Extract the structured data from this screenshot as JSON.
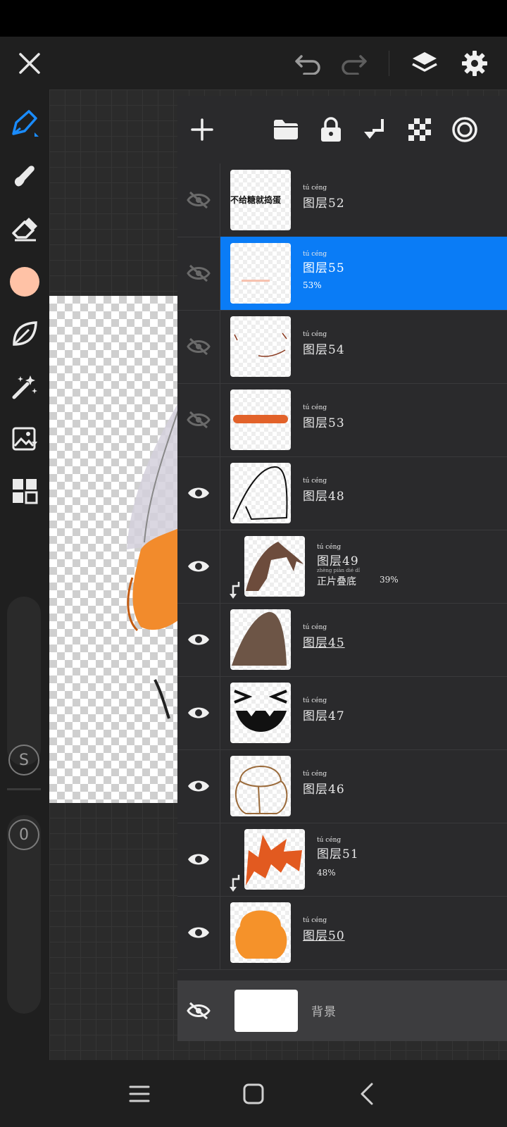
{
  "app": {
    "accent_color": "#0a7cf6",
    "brush_color": "#ffc2a6"
  },
  "top_bar": {
    "icons": [
      "close-icon",
      "undo-icon",
      "redo-icon",
      "layers-icon",
      "settings-icon"
    ]
  },
  "left_toolbar": {
    "tools": [
      "pen-icon",
      "smudge-icon",
      "eraser-icon",
      "color-swatch",
      "shape-leaf-icon",
      "magic-wand-icon",
      "image-import-icon",
      "materials-grid-icon"
    ],
    "size_label": "S",
    "opacity_label": "0"
  },
  "layers_toolbar": {
    "icons": [
      "add-layer-icon",
      "folder-icon",
      "lock-icon",
      "merge-down-icon",
      "transparency-icon",
      "blend-target-icon"
    ]
  },
  "layers": [
    {
      "name": "图层52",
      "ruby": "tú céng",
      "visible": false,
      "selected": false,
      "thumb_text": "不给糖就捣蛋",
      "sub": ""
    },
    {
      "name": "图层55",
      "ruby": "tú céng",
      "visible": false,
      "selected": true,
      "sub": "53%"
    },
    {
      "name": "图层54",
      "ruby": "tú céng",
      "visible": false,
      "selected": false,
      "sub": ""
    },
    {
      "name": "图层53",
      "ruby": "tú céng",
      "visible": false,
      "selected": false,
      "sub": ""
    },
    {
      "name": "图层48",
      "ruby": "tú céng",
      "visible": true,
      "selected": false,
      "sub": ""
    },
    {
      "name": "图层49",
      "ruby": "tú céng",
      "visible": true,
      "selected": false,
      "sub": "正片叠底",
      "sub_ruby": "zhèng piàn dié dǐ",
      "opacity": "39%",
      "clipped": true
    },
    {
      "name": "图层45",
      "ruby": "tú céng",
      "visible": true,
      "selected": false,
      "sub": "",
      "underline": true
    },
    {
      "name": "图层47",
      "ruby": "tú céng",
      "visible": true,
      "selected": false,
      "sub": ""
    },
    {
      "name": "图层46",
      "ruby": "tú céng",
      "visible": true,
      "selected": false,
      "sub": ""
    },
    {
      "name": "图层51",
      "ruby": "tú céng",
      "visible": true,
      "selected": false,
      "sub": "48%",
      "clipped": true
    },
    {
      "name": "图层50",
      "ruby": "tú céng",
      "visible": true,
      "selected": false,
      "sub": "",
      "underline": true
    }
  ],
  "background_layer": {
    "name": "背景",
    "visible": false
  },
  "nav_bar": {
    "icons": [
      "recent-apps-icon",
      "home-icon",
      "back-icon"
    ]
  }
}
